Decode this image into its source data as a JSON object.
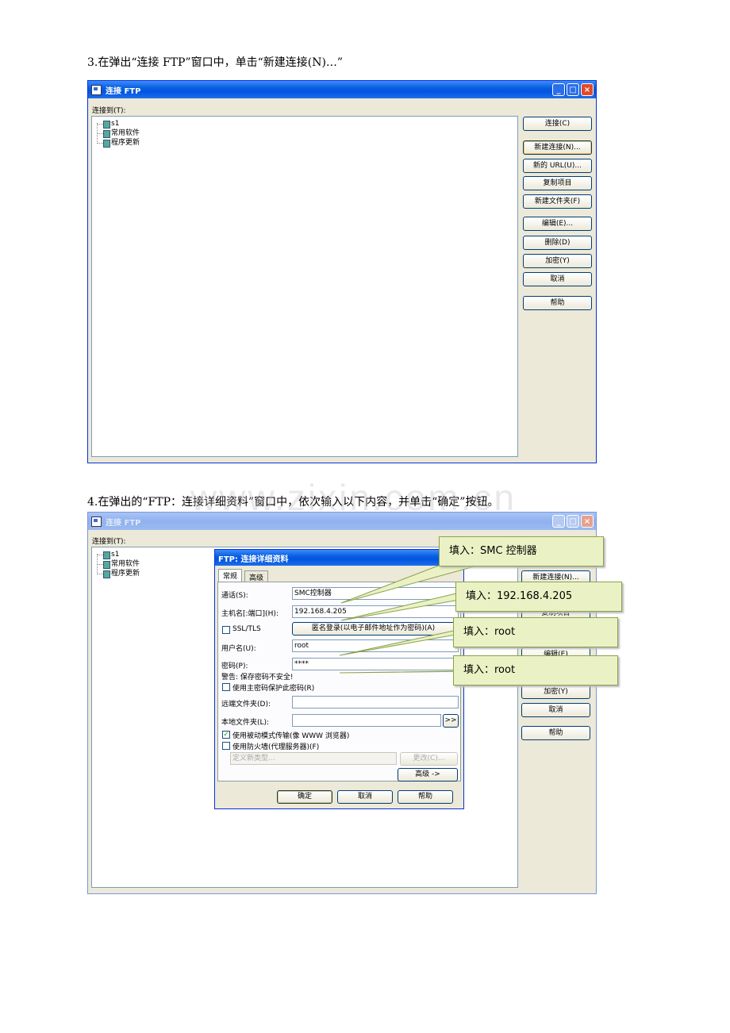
{
  "captions": {
    "step3": "3.在弹出“连接 FTP”窗口中，单击“新建连接(N)…”",
    "step4": "4.在弹出的“FTP：连接详细资料”窗口中，依次输入以下内容，并单击“确定”按钮。"
  },
  "watermark": "www.zixin.com.cn",
  "ftp_window": {
    "title": "连接 FTP",
    "connect_to_label": "连接到(T):",
    "tree_items": [
      "s1",
      "常用软件",
      "程序更新"
    ],
    "buttons": [
      "连接(C)",
      "新建连接(N)...",
      "新的 URL(U)...",
      "复制项目",
      "新建文件夹(F)",
      "编辑(E)...",
      "删除(D)",
      "加密(Y)",
      "取消",
      "帮助"
    ],
    "partial_buttons": [
      "新建连接(N)...",
      "复制项目",
      "编辑(E)",
      "加密(Y)",
      "取消",
      "帮助"
    ]
  },
  "details_dialog": {
    "title": "FTP: 连接详细资料",
    "tabs": [
      "常规",
      "高级"
    ],
    "name_label": "通话(S):",
    "name_value": "SMC控制器",
    "host_label": "主机名[:端口](H):",
    "host_value": "192.168.4.205",
    "ssl_label": "SSL/TLS",
    "anon_button": "匿名登录(以电子邮件地址作为密码)(A)",
    "user_label": "用户名(U):",
    "user_value": "root",
    "pass_label": "密码(P):",
    "pass_value": "****",
    "warning": "警告: 保存密码不安全!",
    "master_pw_label": "使用主密码保护此密码(R)",
    "remote_label": "远端文件夹(D):",
    "local_label": "本地文件夹(L):",
    "browse_button": ">>",
    "passive_label": "使用被动模式传输(像 WWW 浏览器)",
    "firewall_label": "使用防火墙(代理服务器)(F)",
    "type_placeholder": "定义新类型...",
    "change_button": "更改(C)...",
    "advanced_button": "高级 ->",
    "ok_button": "确定",
    "cancel_button": "取消",
    "help_button": "帮助"
  },
  "callouts": [
    "填入：SMC 控制器",
    "填入：192.168.4.205",
    "填入：root",
    "填入：root"
  ]
}
